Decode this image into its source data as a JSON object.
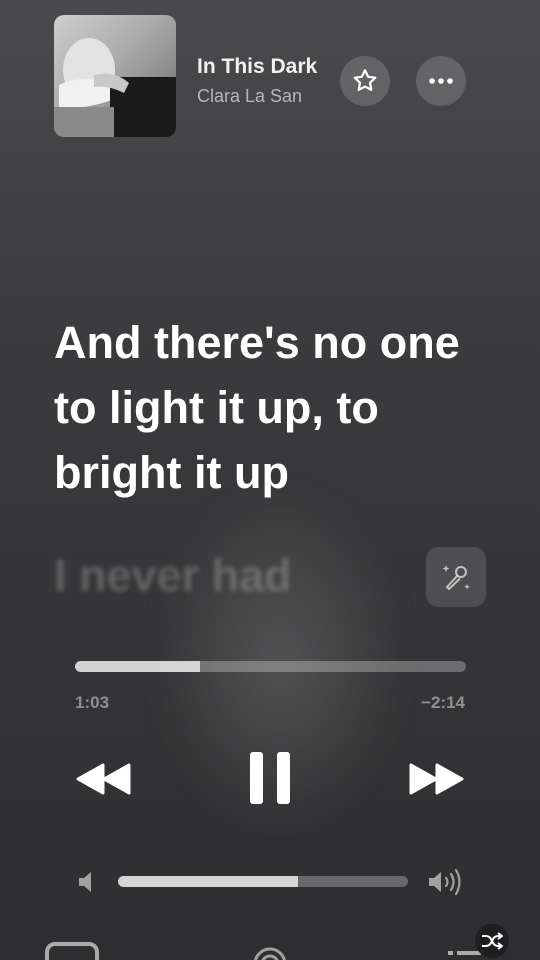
{
  "now_playing": {
    "title": "In This Dark",
    "artist": "Clara La San"
  },
  "icons": {
    "artwork": "album-artwork",
    "favorite": "star-icon",
    "more": "ellipsis-icon",
    "sing": "microphone-sparkle-icon",
    "rewind": "backward-icon",
    "pause": "pause-icon",
    "forward": "forward-icon",
    "volume_low": "speaker-low-icon",
    "volume_high": "speaker-high-icon",
    "airplay": "airplay-icon",
    "broadcast": "broadcast-icon",
    "queue": "queue-list-icon",
    "shuffle": "shuffle-icon"
  },
  "lyrics": {
    "previous": "",
    "current": "And there's no one to light it up, to bright it up",
    "next": "I never had"
  },
  "playback": {
    "elapsed": "1:03",
    "remaining": "−2:14",
    "progress_fraction": 0.32,
    "is_playing": true
  },
  "volume": {
    "level_fraction": 0.62
  },
  "colors": {
    "background": "#3b3b3d",
    "foreground": "#ffffff",
    "muted": "#b7b7b9"
  }
}
